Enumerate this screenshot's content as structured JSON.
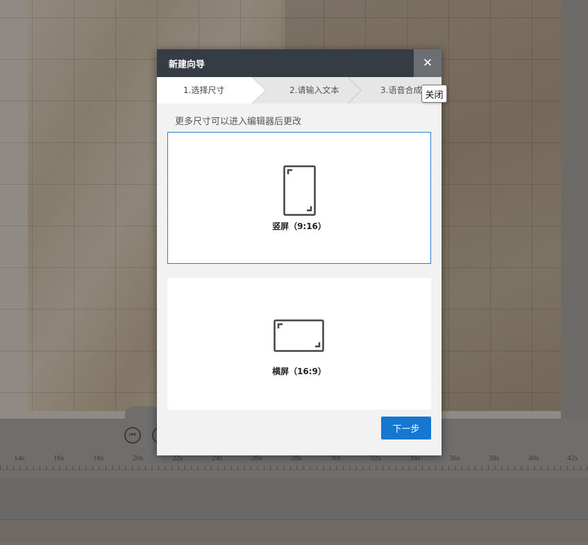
{
  "modal": {
    "title": "新建向导",
    "close_symbol": "✕",
    "close_tooltip": "关闭",
    "steps": [
      {
        "label": "1.选择尺寸",
        "active": true
      },
      {
        "label": "2.请输入文本",
        "active": false
      },
      {
        "label": "3.语音合成",
        "active": false
      }
    ],
    "hint": "更多尺寸可以进入编辑器后更改",
    "options": [
      {
        "label": "竖屏（9:16）",
        "icon": "portrait-frame-icon",
        "selected": true
      },
      {
        "label": "横屏（16:9）",
        "icon": "landscape-frame-icon",
        "selected": false
      }
    ],
    "next_label": "下一步",
    "accent_color": "#1677d2"
  },
  "timeline": {
    "ruler_labels": [
      "14s",
      "16s",
      "18s",
      "20s",
      "22s",
      "24s",
      "26s",
      "28s",
      "30s",
      "32s",
      "34s",
      "36s",
      "38s",
      "40s",
      "42s"
    ]
  }
}
